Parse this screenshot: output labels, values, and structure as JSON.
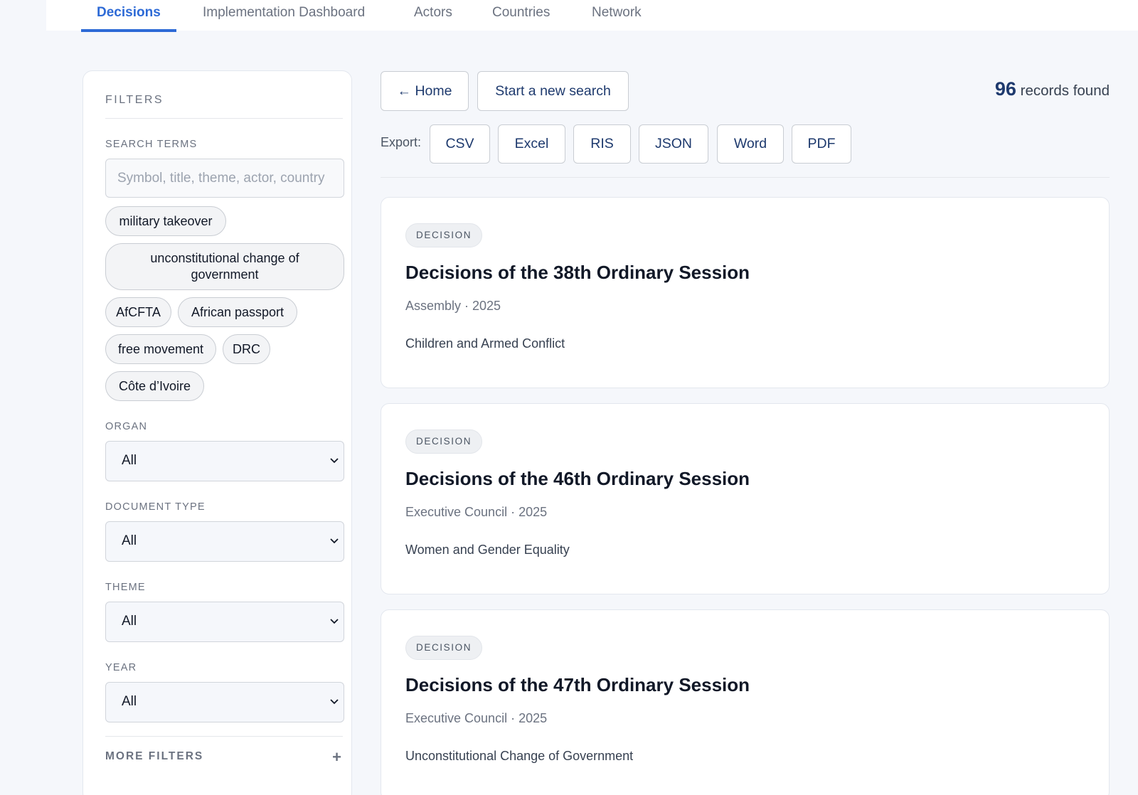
{
  "nav": {
    "tabs": [
      {
        "label": "Decisions",
        "active": true
      },
      {
        "label": "Implementation Dashboard",
        "active": false
      },
      {
        "label": "Actors",
        "active": false
      },
      {
        "label": "Countries",
        "active": false
      },
      {
        "label": "Network",
        "active": false
      }
    ]
  },
  "filters": {
    "title": "FILTERS",
    "search_label": "SEARCH TERMS",
    "search_placeholder": "Symbol, title, theme, actor, country",
    "search_value": "",
    "suggestions": [
      "military takeover",
      "unconstitutional change of government",
      "AfCFTA",
      "African passport",
      "free movement",
      "DRC",
      "Côte d’Ivoire"
    ],
    "organ": {
      "label": "ORGAN",
      "value": "All"
    },
    "document_type": {
      "label": "DOCUMENT TYPE",
      "value": "All"
    },
    "theme": {
      "label": "THEME",
      "value": "All"
    },
    "year": {
      "label": "YEAR",
      "value": "All"
    },
    "more_filters_label": "MORE FILTERS",
    "more_filters_icon": "plus-icon"
  },
  "actions": {
    "home_label": "← Home",
    "new_search_label": "Start a new search",
    "export_label": "Export:",
    "export_formats": [
      "CSV",
      "Excel",
      "RIS",
      "JSON",
      "Word",
      "PDF"
    ]
  },
  "results": {
    "count": "96",
    "count_suffix": "records found",
    "items": [
      {
        "badge": "DECISION",
        "title": "Decisions of the 38th Ordinary Session",
        "meta": "Assembly · 2025",
        "theme": "Children and Armed Conflict"
      },
      {
        "badge": "DECISION",
        "title": "Decisions of the 46th Ordinary Session",
        "meta": "Executive Council · 2025",
        "theme": "Women and Gender Equality"
      },
      {
        "badge": "DECISION",
        "title": "Decisions of the 47th Ordinary Session",
        "meta": "Executive Council · 2025",
        "theme": "Unconstitutional Change of Government"
      }
    ]
  },
  "colors": {
    "accent": "#2d6ad6",
    "navy": "#1e3a6e",
    "background": "#f5f7fb"
  }
}
